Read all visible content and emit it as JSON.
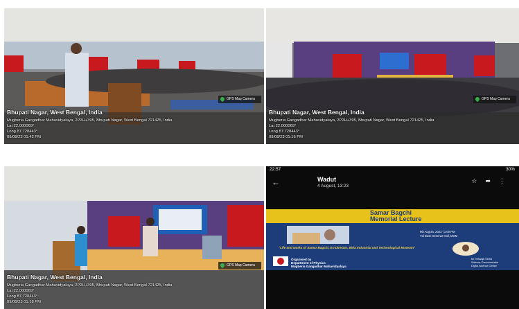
{
  "photos": [
    {
      "place": "Bhupati Nagar, West Bengal, India",
      "address": "Mugberia Gangadhar Mahavidyalaya, 2P2H+395, Bhupati Nagar, West Bengal 721425, India",
      "lat": "Lat 22.000069°",
      "long": "Long 87.728443°",
      "datetime": "09/08/23 01:42 PM",
      "badge": "GPS Map Camera"
    },
    {
      "place": "Bhupati Nagar, West Bengal, India",
      "address": "Mugberia Gangadhar Mahavidyalaya, 2P2H+395, Bhupati Nagar, West Bengal 721425, India",
      "lat": "Lat 22.000069°",
      "long": "Long 87.728443°",
      "datetime": "09/08/23 01:16 PM",
      "badge": "GPS Map Camera"
    },
    {
      "place": "Bhupati Nagar, West Bengal, India",
      "address": "Mugberia Gangadhar Mahavidyalaya, 2P2H+395, Bhupati Nagar, West Bengal 721425, India",
      "lat": "Lat 22.000069°",
      "long": "Long 87.728443°",
      "datetime": "09/08/23 01:18 PM",
      "badge": "GPS Map Camera"
    }
  ],
  "phone": {
    "status_time": "22:57",
    "battery": "30%",
    "sender": "Wadut",
    "when": "4 August, 13:23",
    "poster": {
      "title_line1": "Samar Bagchi",
      "title_line2": "Memorial Lecture",
      "date_line1": "9th August, 2023 | 1:00 PM",
      "date_line2": "Tdi Bose Seminar Hall, MGM",
      "talk": "\"Life and works of Samar Bagchi, Ex-Director, Birla Industrial and Technological Museum\"",
      "org_line1": "Organised by",
      "org_line2": "Department of Physics",
      "org_line3": "Mugberia Gangadhar Mahavidyalaya",
      "speaker_line1": "Mr. Biswajit Sinha",
      "speaker_line2": "Science Communicator",
      "speaker_line3": "Digha Science Centre"
    }
  },
  "colors": {
    "poster_yellow": "#e7c21b",
    "poster_blue": "#1d3d7a",
    "curtain_red": "#c8191f",
    "wall_purple": "#5a3f80",
    "gps_green": "#35b24a"
  }
}
